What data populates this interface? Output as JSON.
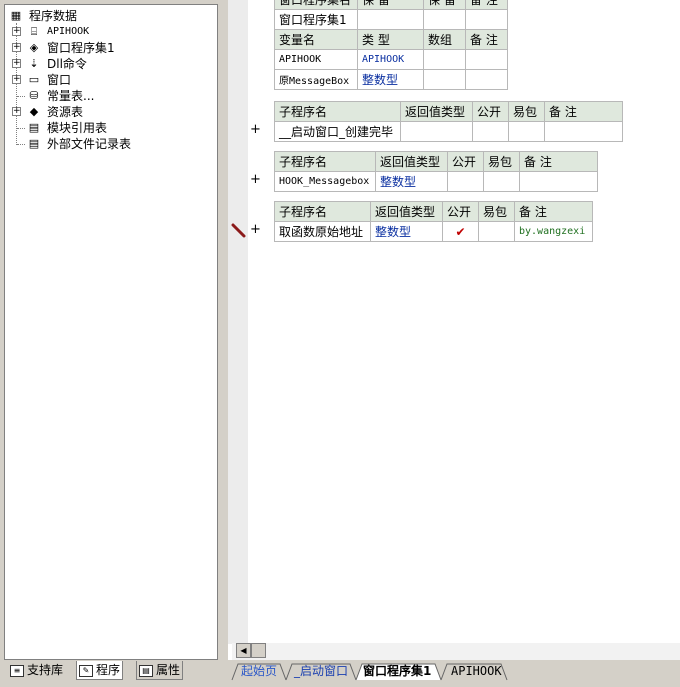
{
  "tree": {
    "root": "程序数据",
    "items": [
      {
        "label": "APIHOOK",
        "icon": "module-icon"
      },
      {
        "label": "窗口程序集1",
        "icon": "assembly-icon"
      },
      {
        "label": "Dll命令",
        "icon": "dll-icon"
      },
      {
        "label": "窗口",
        "icon": "window-icon"
      },
      {
        "label": "常量表...",
        "icon": "constant-icon"
      },
      {
        "label": "资源表",
        "icon": "resource-icon"
      },
      {
        "label": "模块引用表",
        "icon": "module-ref-icon"
      },
      {
        "label": "外部文件记录表",
        "icon": "file-record-icon"
      }
    ]
  },
  "editor": {
    "assembly_table": {
      "headers": [
        "窗口程序集名",
        "保 留",
        "保 留",
        "备 注"
      ],
      "row": [
        "窗口程序集1",
        "",
        "",
        ""
      ]
    },
    "var_table": {
      "headers": [
        "变量名",
        "类 型",
        "数组",
        "备 注"
      ],
      "rows": [
        [
          "APIHOOK",
          "APIHOOK",
          "",
          ""
        ],
        [
          "原MessageBox",
          "整数型",
          "",
          ""
        ]
      ]
    },
    "sub1": {
      "headers": [
        "子程序名",
        "返回值类型",
        "公开",
        "易包",
        "备 注"
      ],
      "row": [
        "__启动窗口_创建完毕",
        "",
        "",
        "",
        ""
      ]
    },
    "sub2": {
      "headers": [
        "子程序名",
        "返回值类型",
        "公开",
        "易包",
        "备 注"
      ],
      "row": [
        "HOOK_Messagebox",
        "整数型",
        "",
        "",
        ""
      ]
    },
    "sub3": {
      "headers": [
        "子程序名",
        "返回值类型",
        "公开",
        "易包",
        "备 注"
      ],
      "row": [
        "取函数原始地址",
        "整数型",
        "✔",
        "",
        "by.wangzexi"
      ]
    },
    "plus": "+"
  },
  "left_tabs": [
    "支持库",
    "程序",
    "属性"
  ],
  "editor_tabs": [
    "起始页",
    "_启动窗口",
    "窗口程序集1",
    "APIHOOK"
  ],
  "colors": {
    "header_bg": "#dfe8dd",
    "type_blue": "#0a2fa0",
    "check_red": "#c00000",
    "note_green": "#207020"
  }
}
